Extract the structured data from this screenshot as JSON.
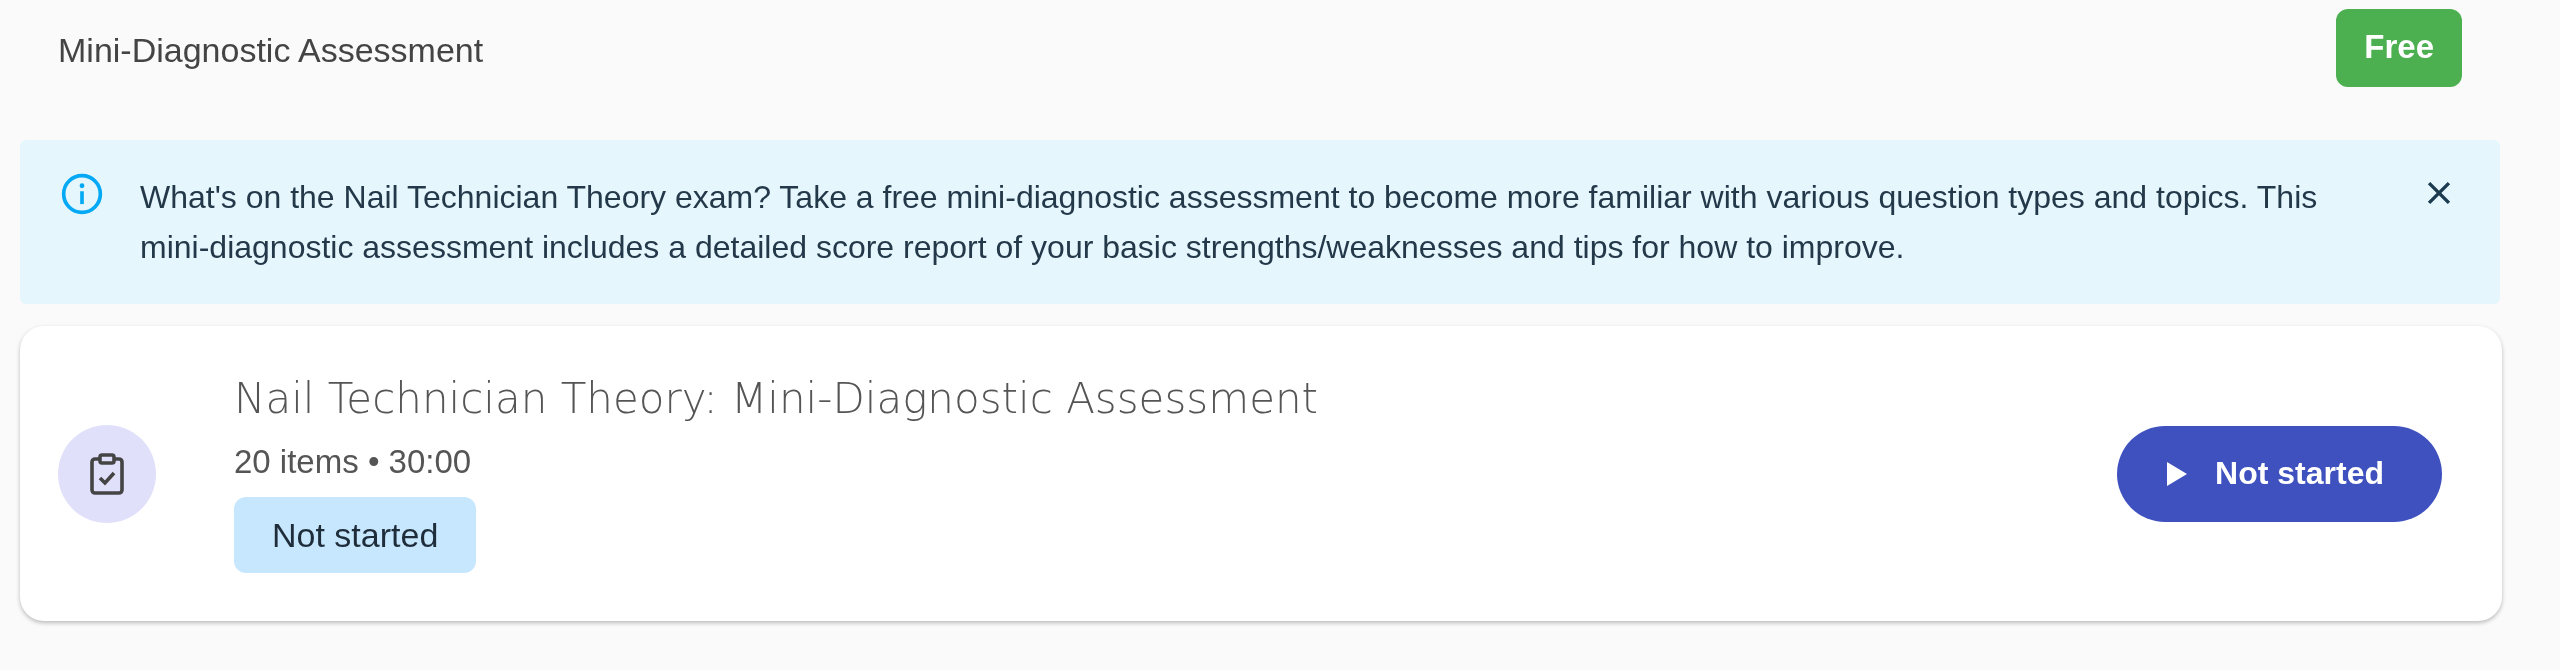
{
  "header": {
    "title": "Mini-Diagnostic Assessment",
    "badge": "Free"
  },
  "alert": {
    "message": "What's on the Nail Technician Theory exam? Take a free mini-diagnostic assessment to become more familiar with various question types and topics. This mini-diagnostic assessment includes a detailed score report of your basic strengths/weaknesses and tips for how to improve.",
    "dismissible": true
  },
  "assessment": {
    "title": "Nail Technician Theory: Mini-Diagnostic Assessment",
    "meta": "20 items • 30:00",
    "status": "Not started",
    "button": "Not started"
  }
}
